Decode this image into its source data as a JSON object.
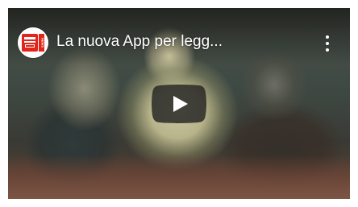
{
  "video": {
    "title": "La nuova App per legg...",
    "channel_logo_text": "NEWS"
  },
  "controls": {
    "play_icon": "play-icon",
    "more_icon": "more-vert-icon"
  },
  "colors": {
    "play_button_bg": "#212121",
    "logo_red": "#e1251b"
  }
}
